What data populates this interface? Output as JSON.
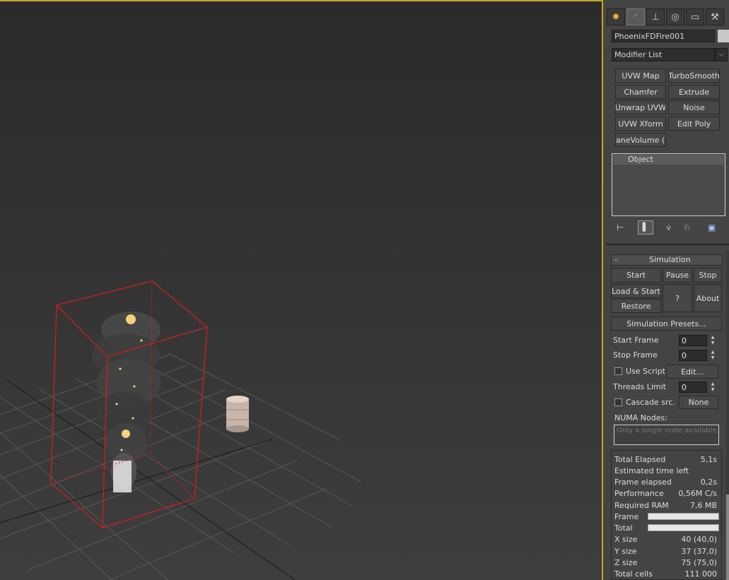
{
  "command_tabs": [
    {
      "name": "create-tab",
      "icon": "sun-icon"
    },
    {
      "name": "modify-tab",
      "icon": "curve-icon"
    },
    {
      "name": "hierarchy-tab",
      "icon": "hierarchy-icon"
    },
    {
      "name": "motion-tab",
      "icon": "motion-icon"
    },
    {
      "name": "display-tab",
      "icon": "monitor-icon"
    },
    {
      "name": "utilities-tab",
      "icon": "hammer-icon"
    }
  ],
  "object_name": "PhoenixFDFire001",
  "modifier_list": "Modifier List",
  "modifier_buttons": [
    "UVW Map",
    "TurboSmooth",
    "Chamfer",
    "Extrude",
    "Unwrap UVW",
    "Noise",
    "UVW Xform",
    "Edit Poly",
    "aneVolume (W"
  ],
  "stack": {
    "item": "Object"
  },
  "simulation": {
    "title": "Simulation",
    "collapse": "-",
    "start": "Start",
    "pause": "Pause",
    "stop": "Stop",
    "load_start": "Load & Start",
    "help": "?",
    "about": "About",
    "restore": "Restore",
    "presets": "Simulation Presets...",
    "start_frame_label": "Start Frame",
    "start_frame": "0",
    "stop_frame_label": "Stop Frame",
    "stop_frame": "0",
    "use_script": "Use Script",
    "edit": "Edit...",
    "threads_label": "Threads Limit",
    "threads": "0",
    "cascade": "Cascade src.",
    "none": "None",
    "numa_label": "NUMA Nodes:",
    "numa_placeholder": "Only a single node available."
  },
  "stats": {
    "total_elapsed_label": "Total Elapsed",
    "total_elapsed": "5,1s",
    "estimated_label": "Estimated time left",
    "frame_elapsed_label": "Frame elapsed",
    "frame_elapsed": "0,2s",
    "performance_label": "Performance",
    "performance": "0,56M C/s",
    "ram_label": "Required RAM",
    "ram": "7,6 MB",
    "frame_label": "Frame",
    "total_label": "Total",
    "xsize_label": "X size",
    "xsize": "40 (40,0)",
    "ysize_label": "Y size",
    "ysize": "37 (37,0)",
    "zsize_label": "Z size",
    "zsize": "75 (75,0)",
    "cells_label": "Total cells",
    "cells": "111 000"
  },
  "progress": {
    "frame": 0,
    "total": 0
  },
  "colors": {
    "viewport_border": "#c8a42a",
    "gizmo": "#cc2020",
    "grid": "#5a5a5a"
  }
}
